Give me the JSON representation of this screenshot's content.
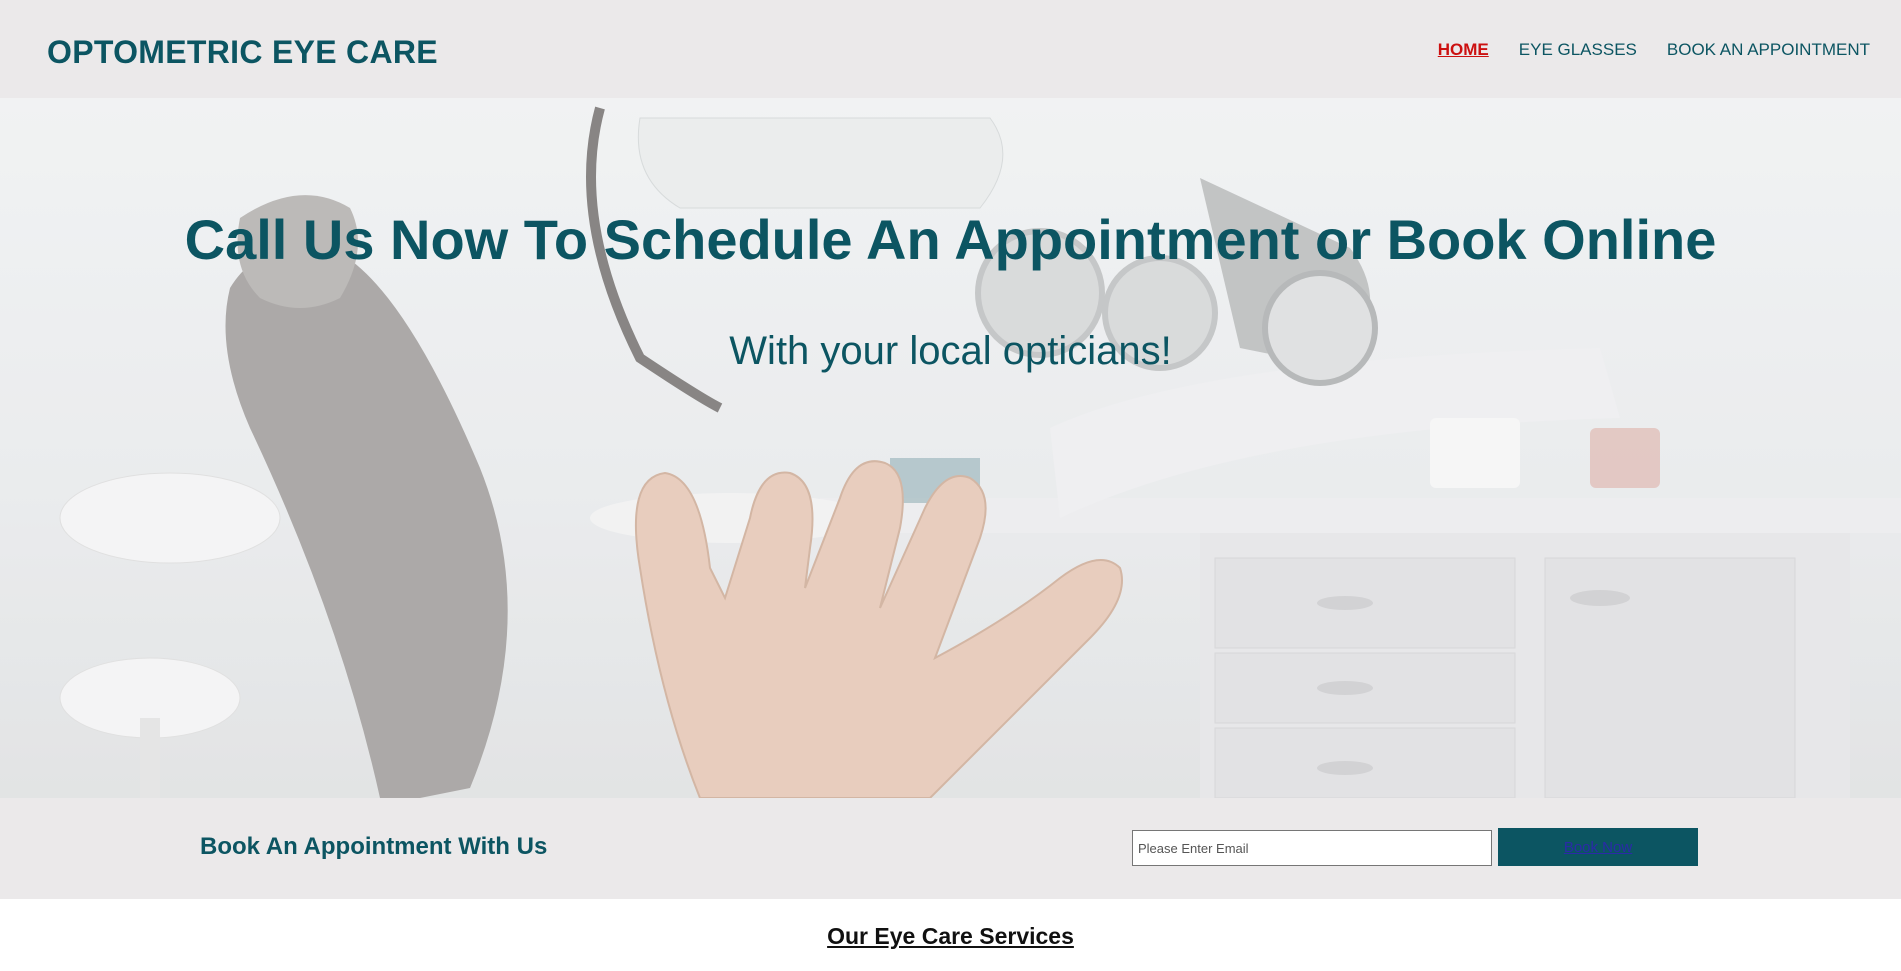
{
  "header": {
    "brand": "OPTOMETRIC EYE CARE",
    "nav": [
      {
        "label": "HOME",
        "active": true
      },
      {
        "label": "EYE GLASSES",
        "active": false
      },
      {
        "label": "BOOK AN APPOINTMENT",
        "active": false
      }
    ]
  },
  "hero": {
    "title": "Call Us Now To Schedule An Appointment or Book Online",
    "subtitle": "With your local opticians!"
  },
  "booking": {
    "label": "Book An Appointment With Us",
    "email_placeholder": "Please Enter Email",
    "email_value": "",
    "button_label": "Book Now"
  },
  "services": {
    "title": "Our Eye Care Services"
  },
  "colors": {
    "brand": "#0c5562",
    "active_nav": "#cc1111",
    "bar_background": "#ebe9ea"
  }
}
